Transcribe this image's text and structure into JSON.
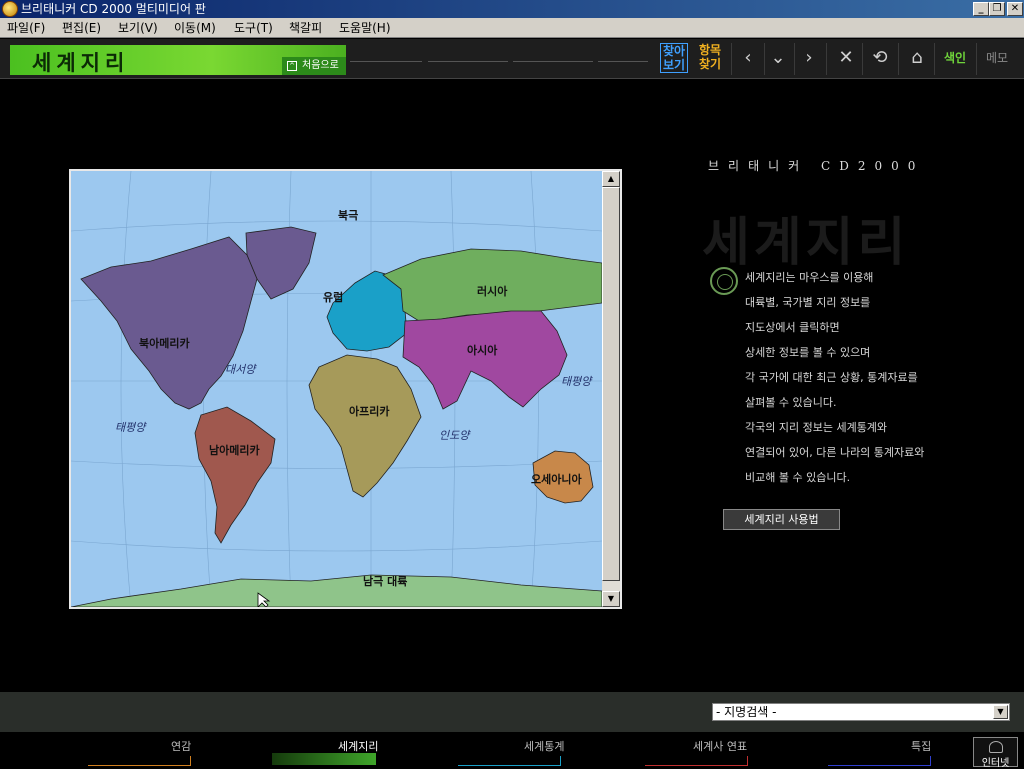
{
  "window": {
    "title": "브리태니커 CD 2000 멀티미디어 판",
    "buttons": [
      "_",
      "❐",
      "✕"
    ]
  },
  "menu": [
    "파일(F)",
    "편집(E)",
    "보기(V)",
    "이동(M)",
    "도구(T)",
    "책갈피",
    "도움말(H)"
  ],
  "header": {
    "section_title": "세계지리",
    "home_link": "처음으로",
    "find_view": [
      "찾아",
      "보기"
    ],
    "item_find": [
      "항목",
      "찾기"
    ],
    "index": "색인",
    "memo": "메모"
  },
  "map": {
    "labels": {
      "north_pole": "북극",
      "europe": "유럽",
      "russia": "러시아",
      "north_america": "북아메리카",
      "asia": "아시아",
      "africa": "아프리카",
      "south_america": "남아메리카",
      "oceania": "오세아니아",
      "antarctica": "남극 대륙"
    },
    "oceans": {
      "atlantic": "대서양",
      "pacific_west": "태평양",
      "pacific_east": "태평양",
      "indian": "인도양"
    },
    "colors": {
      "ocean": "#9cc8ef",
      "north_america": "#6a5a90",
      "europe": "#1aa0c8",
      "russia": "#6fae5e",
      "asia": "#a048a0",
      "africa": "#a69a5a",
      "south_america": "#a0584e",
      "oceania": "#c8884a",
      "antarctica": "#8fc48a"
    }
  },
  "panel": {
    "brand": "브리태니커 CD2000",
    "watermark": "세계지리",
    "description": [
      "세계지리는 마우스를 이용해",
      "대륙별, 국가별 지리 정보를",
      "지도상에서 클릭하면",
      "상세한 정보를 볼 수 있으며",
      "각 국가에 대한 최근 상황, 통계자료를",
      "살펴볼 수 있습니다.",
      "각국의 지리 정보는 세계통계와",
      "연결되어 있어, 다른 나라의 통계자료와",
      "비교해 볼 수 있습니다."
    ],
    "howto_button": "세계지리 사용법"
  },
  "search": {
    "place_search": "- 지명검색 -"
  },
  "bottom_nav": {
    "tabs": [
      "연감",
      "세계지리",
      "세계통계",
      "세계사 연표",
      "특집"
    ],
    "active": "세계지리",
    "internet": "인터넷"
  }
}
